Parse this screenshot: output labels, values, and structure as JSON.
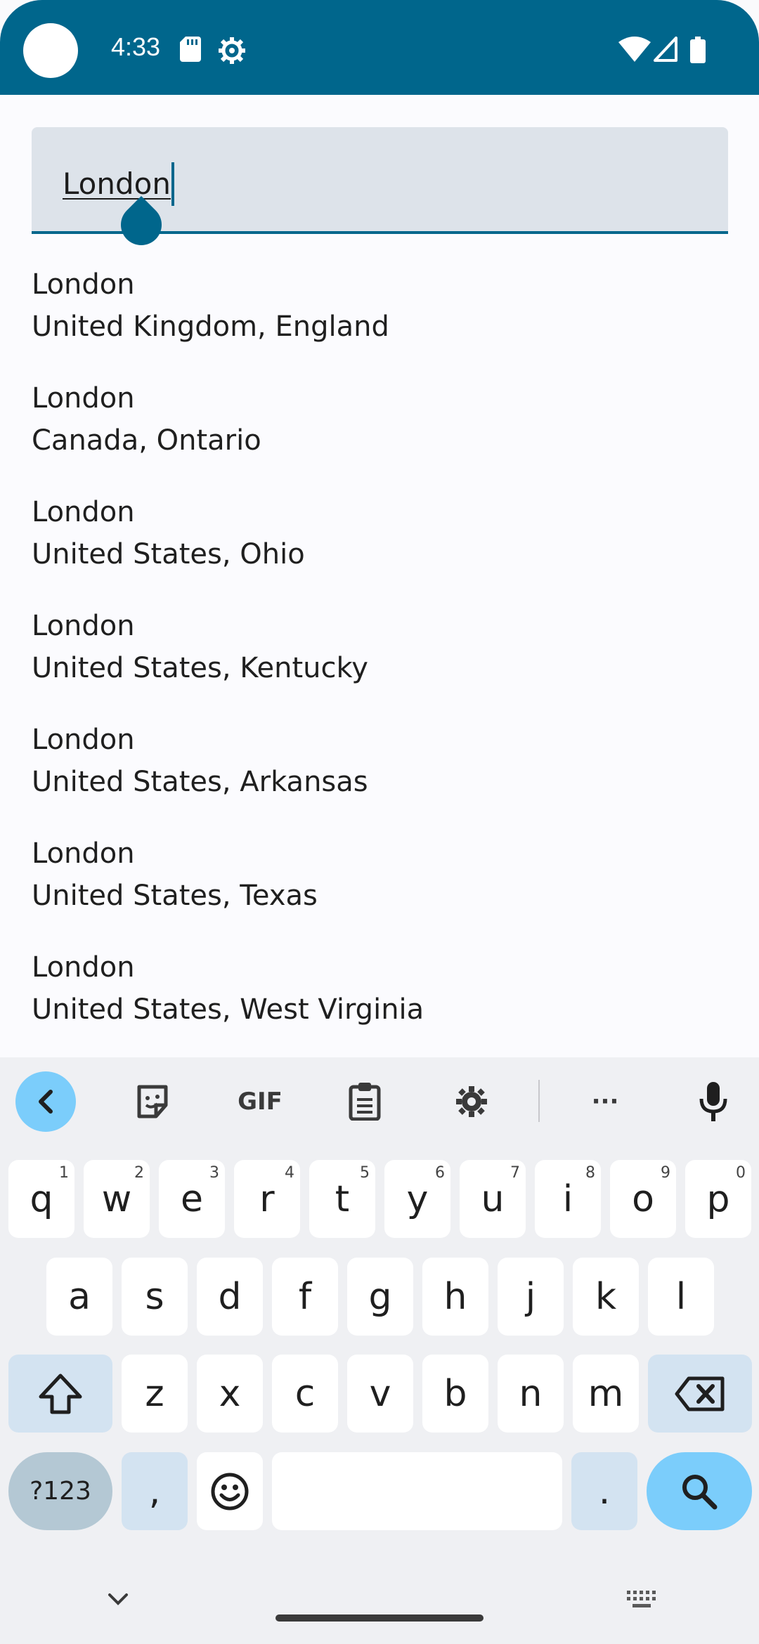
{
  "status_bar": {
    "time": "4:33",
    "icons": [
      "sd-card-icon",
      "settings-gear-icon",
      "wifi-icon",
      "signal-icon",
      "battery-icon"
    ]
  },
  "search": {
    "value": "London"
  },
  "results": [
    {
      "city": "London",
      "region": "United Kingdom, England"
    },
    {
      "city": "London",
      "region": "Canada, Ontario"
    },
    {
      "city": "London",
      "region": "United States, Ohio"
    },
    {
      "city": "London",
      "region": "United States, Kentucky"
    },
    {
      "city": "London",
      "region": "United States, Arkansas"
    },
    {
      "city": "London",
      "region": "United States, Texas"
    },
    {
      "city": "London",
      "region": "United States, West Virginia"
    }
  ],
  "keyboard": {
    "toolbar": {
      "gif_label": "GIF",
      "more_label": "···"
    },
    "row1": [
      {
        "k": "q",
        "h": "1"
      },
      {
        "k": "w",
        "h": "2"
      },
      {
        "k": "e",
        "h": "3"
      },
      {
        "k": "r",
        "h": "4"
      },
      {
        "k": "t",
        "h": "5"
      },
      {
        "k": "y",
        "h": "6"
      },
      {
        "k": "u",
        "h": "7"
      },
      {
        "k": "i",
        "h": "8"
      },
      {
        "k": "o",
        "h": "9"
      },
      {
        "k": "p",
        "h": "0"
      }
    ],
    "row2": [
      "a",
      "s",
      "d",
      "f",
      "g",
      "h",
      "j",
      "k",
      "l"
    ],
    "row3": [
      "z",
      "x",
      "c",
      "v",
      "b",
      "n",
      "m"
    ],
    "sym_label": "?123",
    "comma_label": ",",
    "period_label": "."
  },
  "colors": {
    "accent": "#00668c",
    "key_accent": "#7bcdfb",
    "field_bg": "#dde3ea"
  }
}
